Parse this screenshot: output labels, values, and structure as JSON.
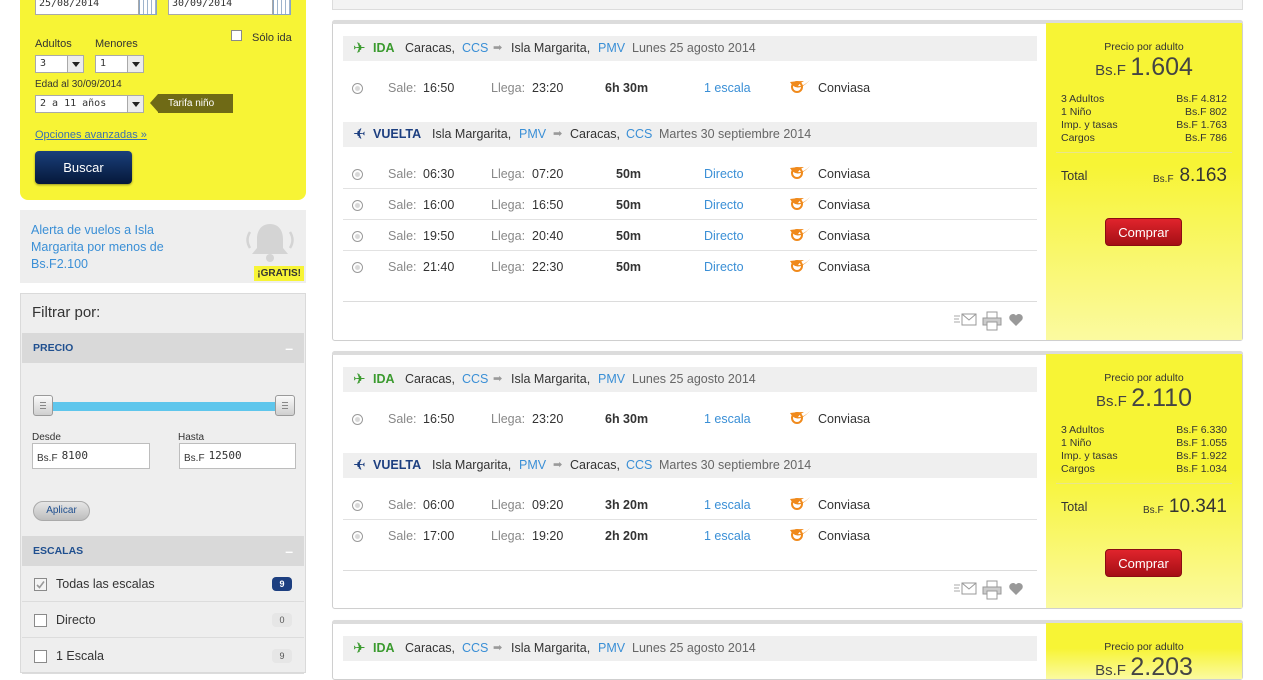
{
  "search": {
    "depart_date": "25/08/2014",
    "return_date": "30/09/2014",
    "solo_ida_label": "Sólo ida",
    "adultos_label": "Adultos",
    "menores_label": "Menores",
    "adultos_value": "3",
    "menores_value": "1",
    "edad_label": "Edad al 30/09/2014",
    "edad_value": "2 a 11 años",
    "tarifa_label": "Tarifa niño",
    "opciones_label": "Opciones avanzadas »",
    "buscar_label": "Buscar"
  },
  "alert": {
    "text": "Alerta de vuelos a Isla Margarita por menos de Bs.F2.100",
    "badge": "¡GRATIS!"
  },
  "filters": {
    "title": "Filtrar por:",
    "precio_header": "PRECIO",
    "desde_label": "Desde",
    "hasta_label": "Hasta",
    "currency": "Bs.F",
    "desde_value": "8100",
    "hasta_value": "12500",
    "aplicar_label": "Aplicar",
    "escalas_header": "ESCALAS",
    "escalas": [
      {
        "label": "Todas las escalas",
        "count": "9",
        "checked": true
      },
      {
        "label": "Directo",
        "count": "0",
        "checked": false
      },
      {
        "label": "1 Escala",
        "count": "9",
        "checked": false
      }
    ]
  },
  "common": {
    "ida": "IDA",
    "vuelta": "VUELTA",
    "sale": "Sale:",
    "llega": "Llega:",
    "airline": "Conviasa",
    "precio_por_adulto": "Precio por adulto",
    "currency": "Bs.F",
    "adultos": "3 Adultos",
    "nino": "1 Niño",
    "imp": "Imp. y tasas",
    "cargos": "Cargos",
    "total": "Total",
    "comprar": "Comprar",
    "caracas": "Caracas,",
    "ccs": "CCS",
    "margarita": "Isla Margarita,",
    "pmv": "PMV",
    "ida_date": "Lunes 25 agosto 2014",
    "vuelta_date": "Martes 30 septiembre 2014",
    "caracas_vuelta": "Caracas,"
  },
  "results": [
    {
      "ida_flights": [
        {
          "sale": "16:50",
          "llega": "23:20",
          "dur": "6h 30m",
          "stops": "1 escala"
        }
      ],
      "vuelta_flights": [
        {
          "sale": "06:30",
          "llega": "07:20",
          "dur": "50m",
          "stops": "Directo"
        },
        {
          "sale": "16:00",
          "llega": "16:50",
          "dur": "50m",
          "stops": "Directo"
        },
        {
          "sale": "19:50",
          "llega": "20:40",
          "dur": "50m",
          "stops": "Directo"
        },
        {
          "sale": "21:40",
          "llega": "22:30",
          "dur": "50m",
          "stops": "Directo"
        }
      ],
      "price_main": "1.604",
      "adultos_val": "Bs.F 4.812",
      "nino_val": "Bs.F 802",
      "imp_val": "Bs.F 1.763",
      "cargos_val": "Bs.F 786",
      "total_val": "8.163"
    },
    {
      "ida_flights": [
        {
          "sale": "16:50",
          "llega": "23:20",
          "dur": "6h 30m",
          "stops": "1 escala"
        }
      ],
      "vuelta_flights": [
        {
          "sale": "06:00",
          "llega": "09:20",
          "dur": "3h 20m",
          "stops": "1 escala"
        },
        {
          "sale": "17:00",
          "llega": "19:20",
          "dur": "2h 20m",
          "stops": "1 escala"
        }
      ],
      "price_main": "2.110",
      "adultos_val": "Bs.F 6.330",
      "nino_val": "Bs.F 1.055",
      "imp_val": "Bs.F 1.922",
      "cargos_val": "Bs.F 1.034",
      "total_val": "10.341"
    },
    {
      "ida_flights": [],
      "vuelta_flights": [],
      "price_main": "2.203"
    }
  ]
}
